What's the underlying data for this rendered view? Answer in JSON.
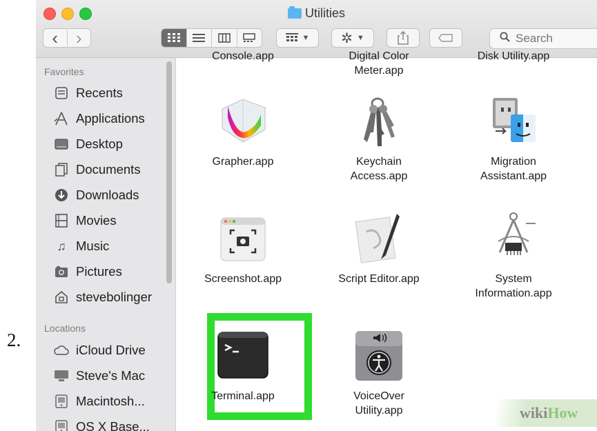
{
  "step_number": "2.",
  "window": {
    "title": "Utilities"
  },
  "toolbar": {
    "back_label": "‹",
    "forward_label": "›",
    "search_placeholder": "Search"
  },
  "sidebar": {
    "favorites_label": "Favorites",
    "favorites": [
      {
        "label": "Recents",
        "icon": "recents-icon"
      },
      {
        "label": "Applications",
        "icon": "applications-icon"
      },
      {
        "label": "Desktop",
        "icon": "desktop-icon"
      },
      {
        "label": "Documents",
        "icon": "documents-icon"
      },
      {
        "label": "Downloads",
        "icon": "downloads-icon"
      },
      {
        "label": "Movies",
        "icon": "movies-icon"
      },
      {
        "label": "Music",
        "icon": "music-icon"
      },
      {
        "label": "Pictures",
        "icon": "pictures-icon"
      },
      {
        "label": "stevebolinger",
        "icon": "home-icon"
      }
    ],
    "locations_label": "Locations",
    "locations": [
      {
        "label": "iCloud Drive",
        "icon": "cloud-icon"
      },
      {
        "label": "Steve's Mac",
        "icon": "computer-icon"
      },
      {
        "label": "Macintosh...",
        "icon": "disk-icon"
      },
      {
        "label": "OS X Base...",
        "icon": "disk-icon"
      }
    ]
  },
  "files": {
    "top_row": [
      {
        "line1": "Console.app",
        "line2": ""
      },
      {
        "line1": "Digital Color",
        "line2": "Meter.app"
      },
      {
        "line1": "Disk Utility.app",
        "line2": ""
      }
    ],
    "row1": [
      {
        "line1": "Grapher.app",
        "line2": ""
      },
      {
        "line1": "Keychain",
        "line2": "Access.app"
      },
      {
        "line1": "Migration",
        "line2": "Assistant.app"
      }
    ],
    "row2": [
      {
        "line1": "Screenshot.app",
        "line2": ""
      },
      {
        "line1": "Script Editor.app",
        "line2": ""
      },
      {
        "line1": "System",
        "line2": "Information.app"
      }
    ],
    "row3": [
      {
        "line1": "Terminal.app",
        "line2": ""
      },
      {
        "line1": "VoiceOver",
        "line2": "Utility.app"
      }
    ]
  },
  "watermark": {
    "part1": "wiki",
    "part2": "How"
  },
  "colors": {
    "highlight": "#2fdc2f",
    "folder_accent": "#5ab6f0"
  }
}
